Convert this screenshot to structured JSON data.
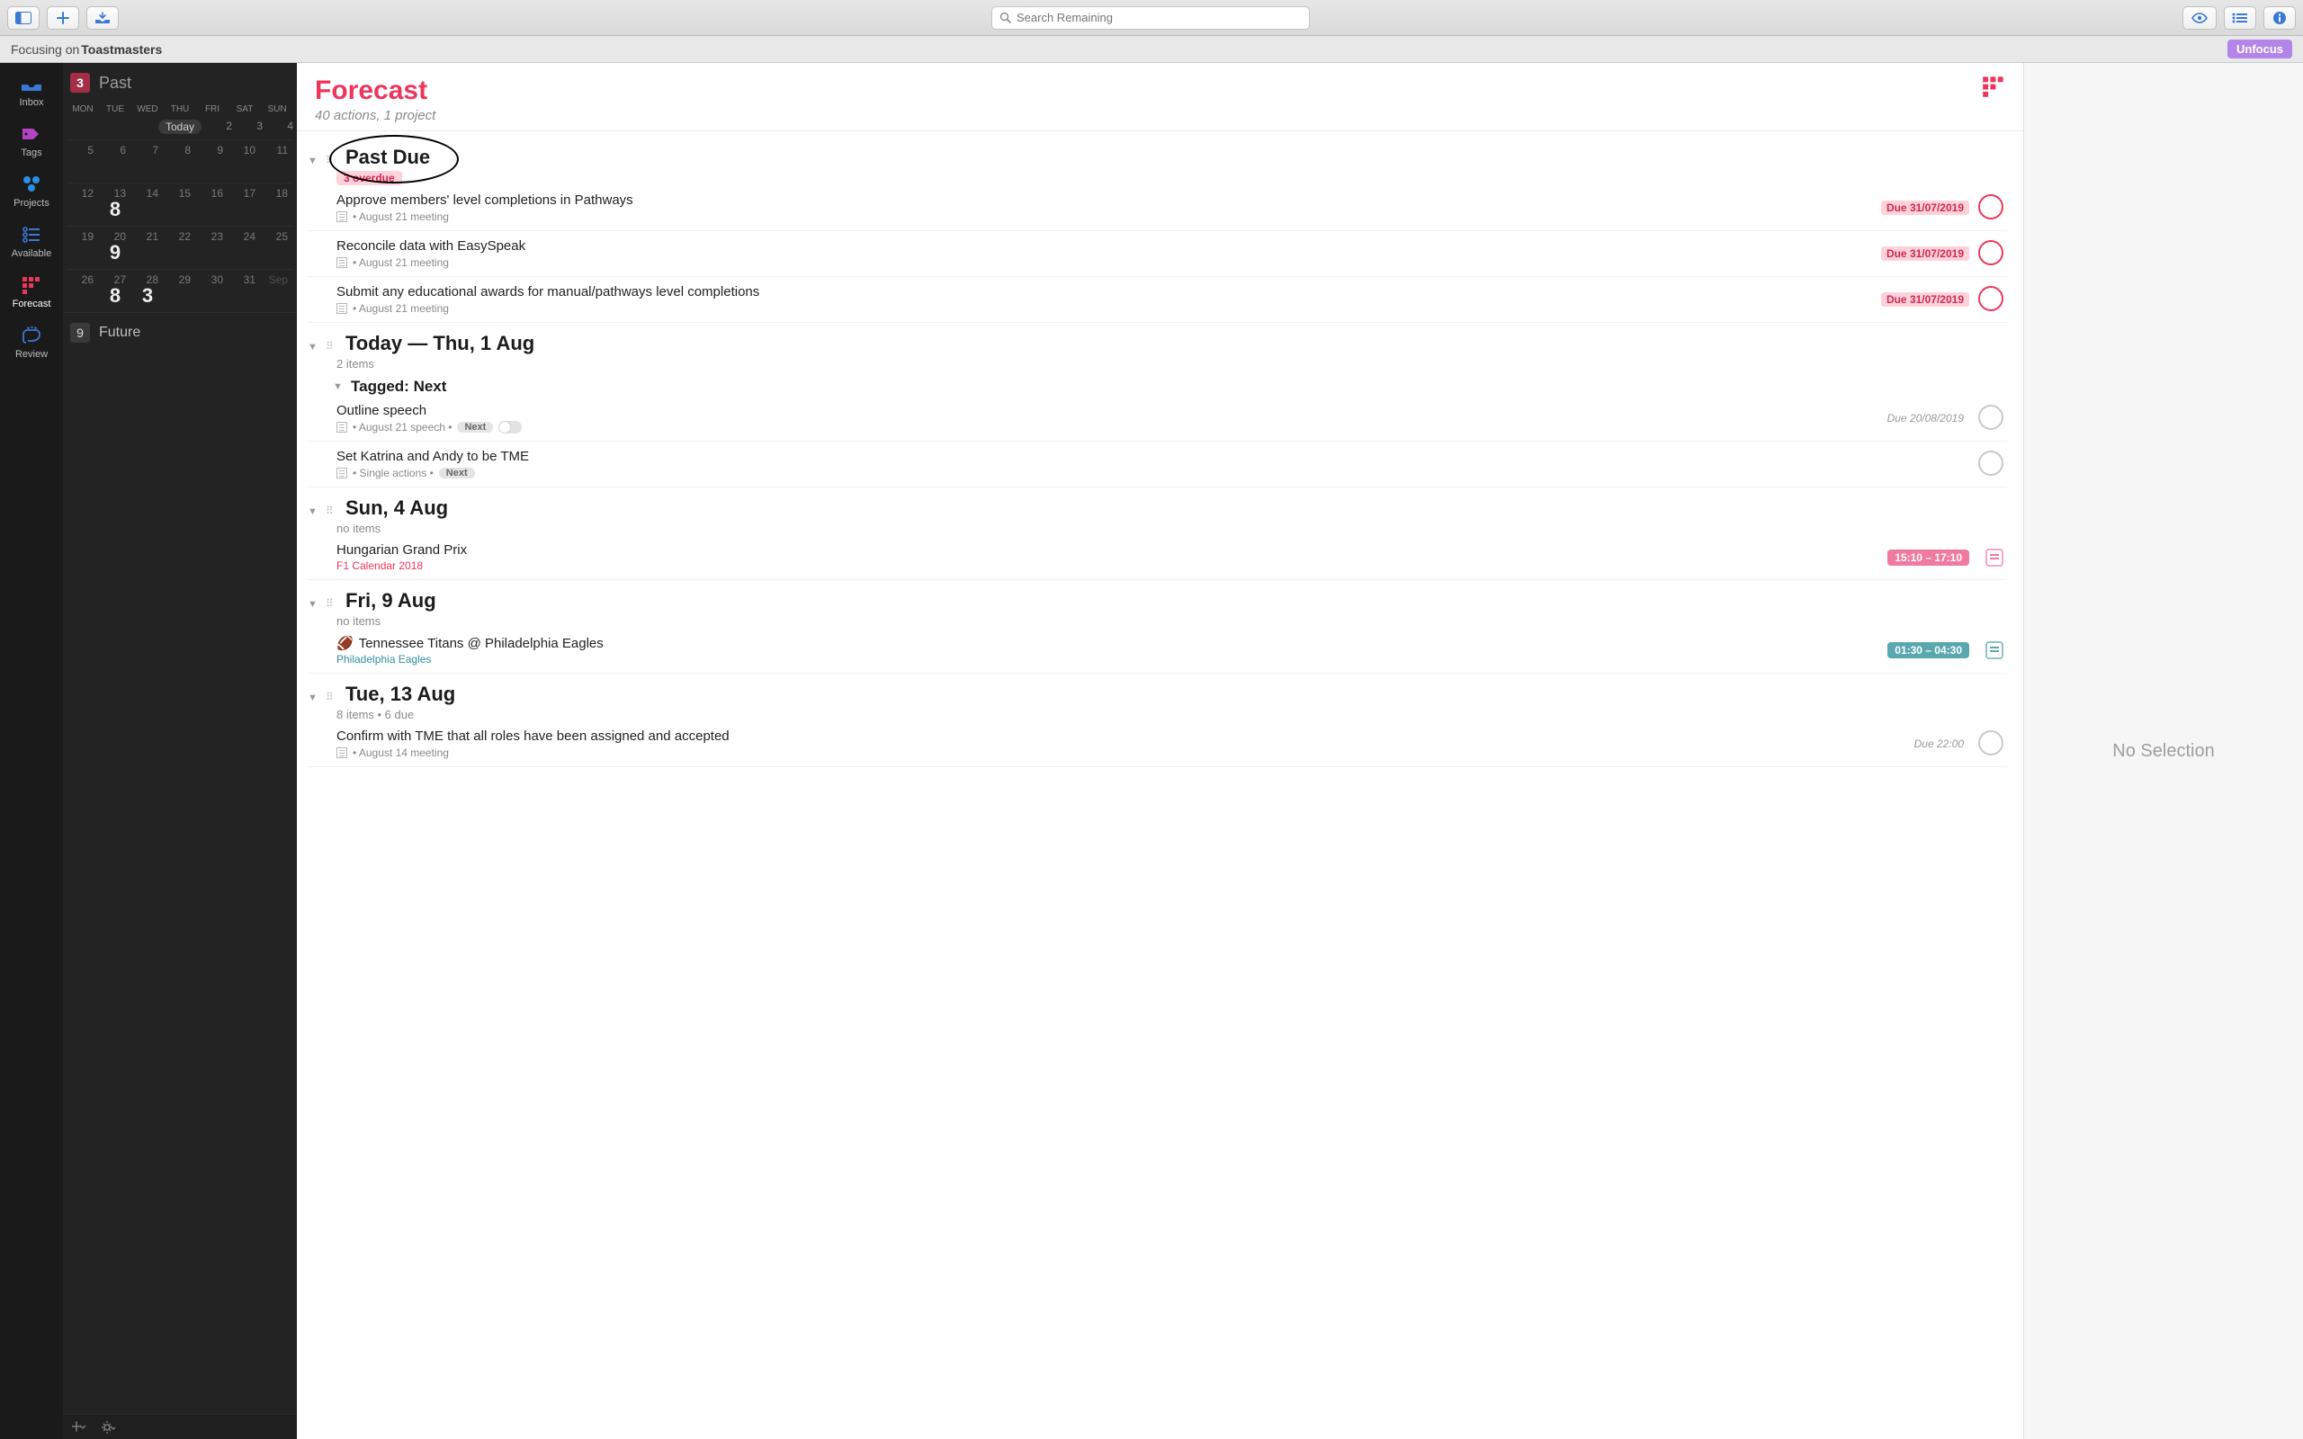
{
  "toolbar": {
    "search_placeholder": "Search Remaining"
  },
  "focus": {
    "prefix": "Focusing on ",
    "name": "Toastmasters",
    "unfocus": "Unfocus"
  },
  "sidebar": {
    "items": [
      {
        "label": "Inbox"
      },
      {
        "label": "Tags"
      },
      {
        "label": "Projects"
      },
      {
        "label": "Available"
      },
      {
        "label": "Forecast"
      },
      {
        "label": "Review"
      }
    ]
  },
  "calendar": {
    "past": {
      "count": "3",
      "label": "Past"
    },
    "week_labels": [
      "MON",
      "TUE",
      "WED",
      "THU",
      "FRI",
      "SAT",
      "SUN"
    ],
    "today_label": "Today",
    "today_row_tail": [
      "2",
      "3",
      "4"
    ],
    "weeks": [
      {
        "days": [
          {
            "n": "5"
          },
          {
            "n": "6"
          },
          {
            "n": "7"
          },
          {
            "n": "8"
          },
          {
            "n": "9"
          },
          {
            "n": "10"
          },
          {
            "n": "11"
          }
        ]
      },
      {
        "days": [
          {
            "n": "12"
          },
          {
            "n": "13",
            "big": "8"
          },
          {
            "n": "14"
          },
          {
            "n": "15"
          },
          {
            "n": "16"
          },
          {
            "n": "17"
          },
          {
            "n": "18"
          }
        ]
      },
      {
        "days": [
          {
            "n": "19"
          },
          {
            "n": "20",
            "big": "9"
          },
          {
            "n": "21"
          },
          {
            "n": "22"
          },
          {
            "n": "23"
          },
          {
            "n": "24"
          },
          {
            "n": "25"
          }
        ]
      },
      {
        "days": [
          {
            "n": "26"
          },
          {
            "n": "27",
            "big": "8"
          },
          {
            "n": "28",
            "big": "3"
          },
          {
            "n": "29"
          },
          {
            "n": "30"
          },
          {
            "n": "31"
          },
          {
            "n": "Sep",
            "dim": true
          }
        ]
      }
    ],
    "future": {
      "count": "9",
      "label": "Future"
    }
  },
  "header": {
    "title": "Forecast",
    "subtitle": "40 actions, 1 project"
  },
  "sections": [
    {
      "id": "past-due",
      "title": "Past Due",
      "meta_pill": "3 overdue",
      "annotated": true,
      "items": [
        {
          "title": "Approve members' level completions in Pathways",
          "project": "August 21 meeting",
          "due": "Due 31/07/2019",
          "due_style": "pink",
          "circle": "pink"
        },
        {
          "title": "Reconcile data with EasySpeak",
          "project": "August 21 meeting",
          "due": "Due 31/07/2019",
          "due_style": "pink",
          "circle": "pink"
        },
        {
          "title": "Submit any educational awards for manual/pathways level completions",
          "project": "August 21 meeting",
          "due": "Due 31/07/2019",
          "due_style": "pink",
          "circle": "pink"
        }
      ]
    },
    {
      "id": "today",
      "title": "Today — Thu, 1 Aug",
      "meta": "2 items",
      "subsection": {
        "title": "Tagged: Next"
      },
      "items": [
        {
          "title": "Outline speech",
          "project": "August 21 speech",
          "tag": "Next",
          "switch": true,
          "due": "Due 20/08/2019",
          "due_style": "grey",
          "circle": "grey"
        },
        {
          "title": "Set Katrina and Andy to be TME",
          "project": "Single actions",
          "tag": "Next",
          "circle": "grey"
        }
      ]
    },
    {
      "id": "sun",
      "title": "Sun, 4 Aug",
      "meta": "no items",
      "events": [
        {
          "title": "Hungarian Grand Prix",
          "sub": "F1 Calendar 2018",
          "sub_style": "pink",
          "time": "15:10 – 17:10",
          "chip": "pink"
        }
      ]
    },
    {
      "id": "fri",
      "title": "Fri, 9 Aug",
      "meta": "no items",
      "events": [
        {
          "emoji": "🏈",
          "title": "Tennessee Titans @ Philadelphia Eagles",
          "sub": "Philadelphia Eagles",
          "sub_style": "teal",
          "time": "01:30 – 04:30",
          "chip": "teal"
        }
      ]
    },
    {
      "id": "tue",
      "title": "Tue, 13 Aug",
      "meta": "8 items • 6 due",
      "items": [
        {
          "title": "Confirm with TME that all roles have been assigned and accepted",
          "project": "August 14 meeting",
          "due": "Due 22:00",
          "due_style": "grey",
          "circle": "grey"
        }
      ]
    }
  ],
  "inspector": {
    "empty": "No Selection"
  }
}
